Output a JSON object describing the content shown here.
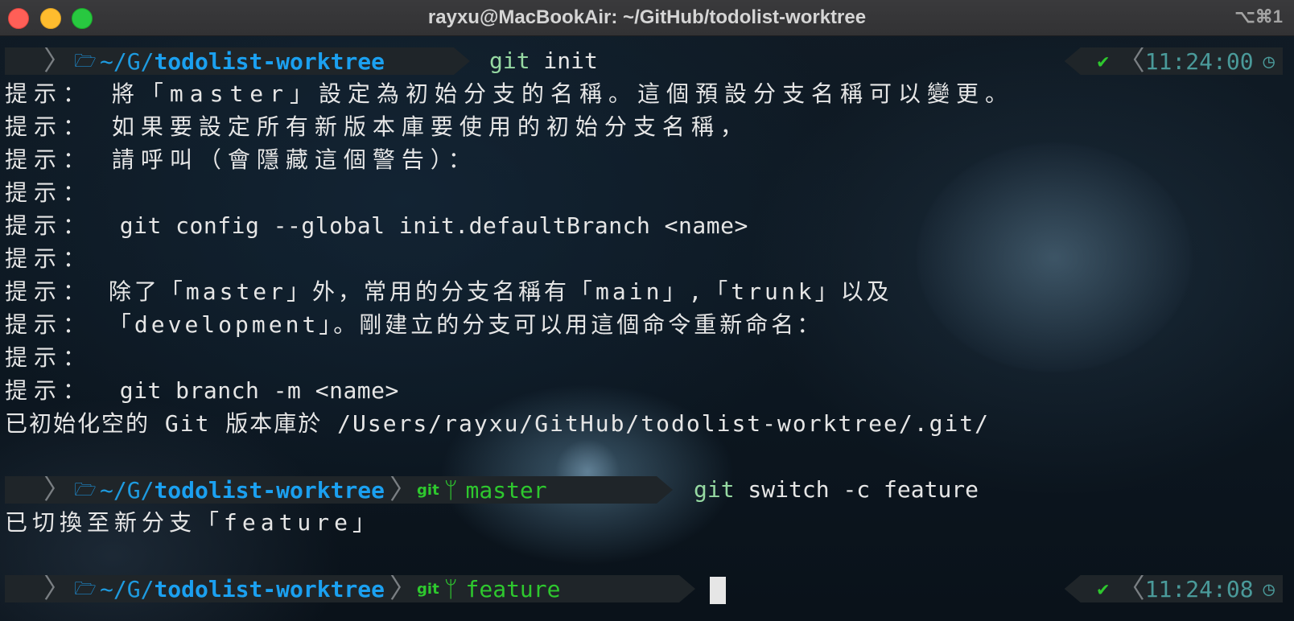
{
  "window": {
    "title": "rayxu@MacBookAir: ~/GitHub/todolist-worktree",
    "shortcut": "⌥⌘1"
  },
  "prompts": [
    {
      "path_prefix": "~/G/",
      "path_repo": "todolist-worktree",
      "command_git": "git",
      "command_rest": " init",
      "status_icon": "check-icon",
      "time": "11:24:00"
    },
    {
      "path_prefix": "~/G/",
      "path_repo": "todolist-worktree",
      "git_label": "git",
      "branch": "master",
      "command_git": "git",
      "command_rest": " switch -c feature"
    },
    {
      "path_prefix": "~/G/",
      "path_repo": "todolist-worktree",
      "git_label": "git",
      "branch": "feature",
      "status_icon": "check-icon",
      "time": "11:24:08"
    }
  ],
  "output": {
    "hint_prefix": "提示：",
    "init_hints": [
      " 將「master」設定為初始分支的名稱。這個預設分支名稱可以變更。",
      " 如果要設定所有新版本庫要使用的初始分支名稱，",
      " 請呼叫（會隱藏這個警告）：",
      "",
      "  git config --global init.defaultBranch <name>",
      "",
      " 除了「master」外，常用的分支名稱有「main」,「trunk」以及",
      " 「development」。剛建立的分支可以用這個命令重新命名：",
      "",
      "  git branch -m <name>"
    ],
    "init_result": "已初始化空的 Git 版本庫於 /Users/rayxu/GitHub/todolist-worktree/.git/",
    "switch_result": "已切換至新分支「feature」"
  }
}
